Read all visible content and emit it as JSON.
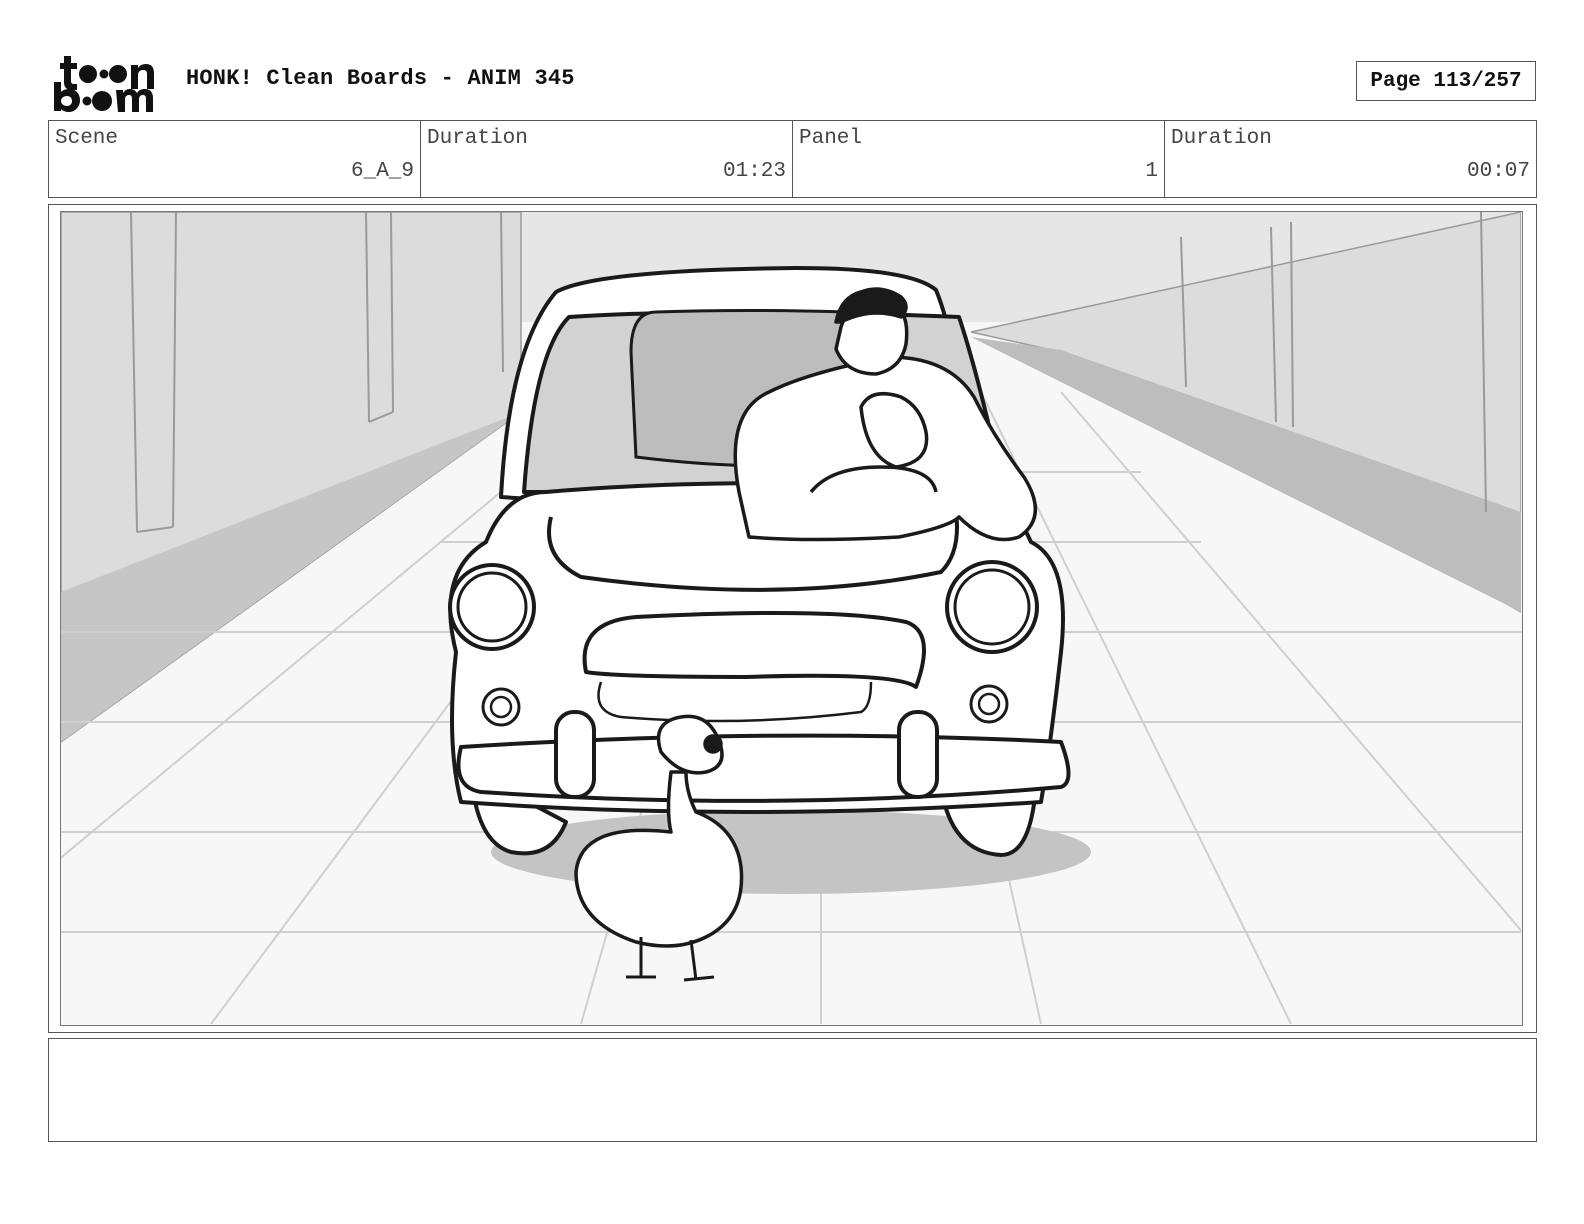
{
  "header": {
    "logo_text": "toon boom",
    "title": "HONK! Clean Boards - ANIM 345",
    "page_label": "Page 113/257"
  },
  "info": [
    {
      "label": "Scene",
      "value": "6_A_9"
    },
    {
      "label": "Duration",
      "value": "01:23"
    },
    {
      "label": "Panel",
      "value": "1"
    },
    {
      "label": "Duration",
      "value": "00:07"
    }
  ],
  "panel": {
    "description": "",
    "colors": {
      "line": "#1a1a1a",
      "shadow": "#c4c4c4",
      "wall": "#d9d9d9",
      "floor": "#f6f6f6"
    }
  },
  "notes": {
    "text": ""
  }
}
